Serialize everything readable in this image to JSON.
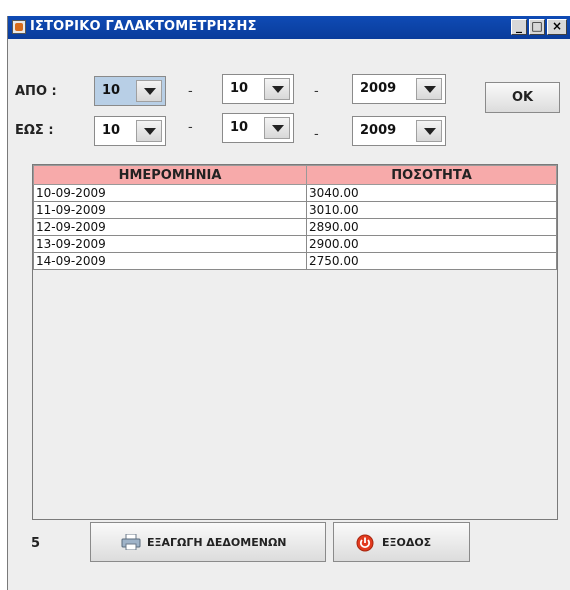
{
  "window": {
    "title": "ΙΣΤΟΡΙΚΟ ΓΑΛΑΚΤΟΜΕΤΡΗΣΗΣ"
  },
  "filters": {
    "from_label": "ΑΠΟ :",
    "to_label": "ΕΩΣ :",
    "separator": "-",
    "from": {
      "day": "10",
      "month": "10",
      "year": "2009"
    },
    "to": {
      "day": "10",
      "month": "10",
      "year": "2009"
    },
    "ok_label": "OK"
  },
  "table": {
    "headers": [
      "ΗΜΕΡΟΜΗΝΙΑ",
      "ΠΟΣΟΤΗΤΑ"
    ],
    "rows": [
      [
        "10-09-2009",
        "3040.00"
      ],
      [
        "11-09-2009",
        "3010.00"
      ],
      [
        "12-09-2009",
        "2890.00"
      ],
      [
        "13-09-2009",
        "2900.00"
      ],
      [
        "14-09-2009",
        "2750.00"
      ]
    ]
  },
  "footer": {
    "count": "5",
    "export_label": "ΕΞΑΓΩΓΗ ΔΕΔΟΜΕΝΩΝ",
    "exit_label": "ΕΞΟΔΟΣ"
  }
}
